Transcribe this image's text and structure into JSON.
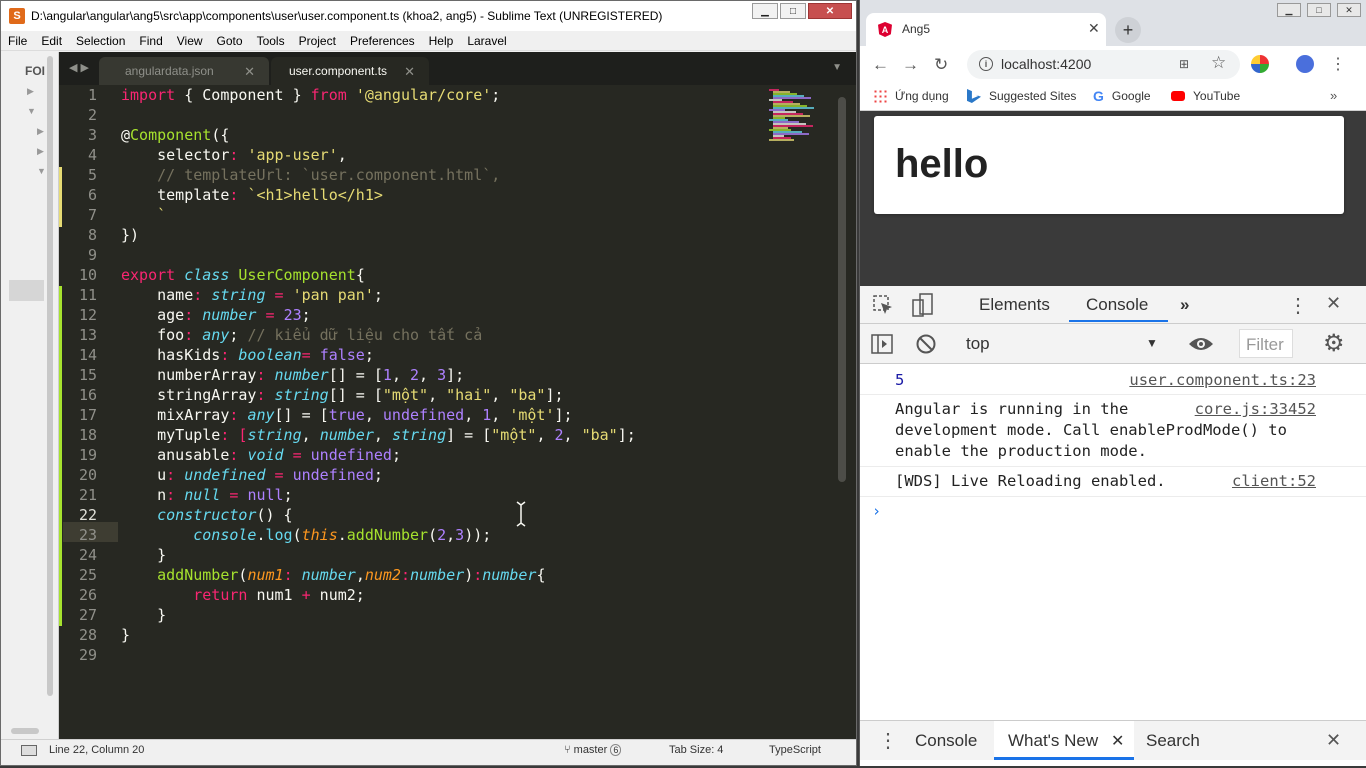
{
  "sublime": {
    "title": "D:\\angular\\angular\\ang5\\src\\app\\components\\user\\user.component.ts (khoa2, ang5) - Sublime Text (UNREGISTERED)",
    "window_controls": {
      "minimize": "▁",
      "maximize": "□",
      "close": "✕"
    },
    "menu": [
      "File",
      "Edit",
      "Selection",
      "Find",
      "View",
      "Goto",
      "Tools",
      "Project",
      "Preferences",
      "Help",
      "Laravel"
    ],
    "sidebar_label": "FOI",
    "tab_nav": "◀ ▶",
    "tabs": [
      {
        "label": "angulardata.json",
        "close": "✕"
      },
      {
        "label": "user.component.ts",
        "close": "✕"
      }
    ],
    "tab_dropdown": "▼",
    "line_numbers": [
      "1",
      "2",
      "3",
      "4",
      "5",
      "6",
      "7",
      "8",
      "9",
      "10",
      "11",
      "12",
      "13",
      "14",
      "15",
      "16",
      "17",
      "18",
      "19",
      "20",
      "21",
      "22",
      "23",
      "24",
      "25",
      "26",
      "27",
      "28",
      "29"
    ],
    "code": {
      "l1": {
        "a": "import",
        "b": " { Component } ",
        "c": "from",
        "d": " ",
        "e": "'@angular/core'",
        "f": ";"
      },
      "l3": {
        "a": "@",
        "b": "Component",
        "c": "({"
      },
      "l4": {
        "a": "    selector",
        "b": ": ",
        "c": "'app-user'",
        "d": ","
      },
      "l5": "    // templateUrl: `user.component.html`,",
      "l6": {
        "a": "    template",
        "b": ": ",
        "c": "`<h1>hello</h1>"
      },
      "l7": "    `",
      "l8": "})",
      "l10": {
        "a": "export",
        "b": " ",
        "c": "class",
        "d": " ",
        "e": "UserComponent",
        "f": "{"
      },
      "l11": {
        "a": "    name",
        "b": ": ",
        "c": "string",
        "d": " = ",
        "e": "'pan pan'",
        "f": ";"
      },
      "l12": {
        "a": "    age",
        "b": ": ",
        "c": "number",
        "d": " = ",
        "e": "23",
        "f": ";"
      },
      "l13": {
        "a": "    foo",
        "b": ": ",
        "c": "any",
        "d": "; ",
        "e": "// kiểu dữ liệu cho tất cả"
      },
      "l14": {
        "a": "    hasKids",
        "b": ": ",
        "c": "boolean",
        "d": "= ",
        "e": "false",
        "f": ";"
      },
      "l15": {
        "a": "    numberArray",
        "b": ": ",
        "c": "number",
        "d": "[] = [",
        "e": "1",
        "f": ", ",
        "g": "2",
        "h": ", ",
        "i": "3",
        "j": "];"
      },
      "l16": {
        "a": "    stringArray",
        "b": ": ",
        "c": "string",
        "d": "[] = [",
        "e": "\"một\"",
        "f": ", ",
        "g": "\"hai\"",
        "h": ", ",
        "i": "\"ba\"",
        "j": "];"
      },
      "l17": {
        "a": "    mixArray",
        "b": ": ",
        "c": "any",
        "d": "[] = [",
        "e": "true",
        "f": ", ",
        "g": "undefined",
        "h": ", ",
        "i": "1",
        "j": ", ",
        "k": "'một'",
        "l": "];"
      },
      "l18": {
        "a": "    myTuple",
        "b": ": [",
        "c": "string",
        "d": ", ",
        "e": "number",
        "f": ", ",
        "g": "string",
        "h": "] = [",
        "i": "\"một\"",
        "j": ", ",
        "k": "2",
        "l": ", ",
        "m": "\"ba\"",
        "n": "];"
      },
      "l19": {
        "a": "    anusable",
        "b": ": ",
        "c": "void",
        "d": " = ",
        "e": "undefined",
        "f": ";"
      },
      "l20": {
        "a": "    u",
        "b": ": ",
        "c": "undefined",
        "d": " = ",
        "e": "undefined",
        "f": ";"
      },
      "l21": {
        "a": "    n",
        "b": ": ",
        "c": "null",
        "d": " = ",
        "e": "null",
        "f": ";"
      },
      "l22": {
        "a": "    constructor",
        "b": "() {"
      },
      "l23": {
        "a": "        ",
        "b": "console",
        "c": ".",
        "d": "log",
        "e": "(",
        "f": "this",
        "g": ".",
        "h": "addNumber",
        "i": "(",
        "j": "2",
        "k": ",",
        "l": "3",
        "m": "));"
      },
      "l24": "    }",
      "l25": {
        "a": "    addNumber",
        "b": "(",
        "c": "num1",
        "d": ": ",
        "e": "number",
        "f": ",",
        "g": "num2",
        "h": ":",
        "i": "number",
        "j": ")",
        "k": ":",
        "l": "number",
        "m": "{"
      },
      "l26": {
        "a": "        ",
        "b": "return",
        "c": " num1 ",
        "d": "+",
        "e": " num2;"
      },
      "l27": "    }",
      "l28": "}"
    },
    "status": {
      "position": "Line 22, Column 20",
      "branch": "master",
      "branch_badge": "6",
      "tab_size": "Tab Size: 4",
      "syntax": "TypeScript"
    }
  },
  "chrome": {
    "tab_title": "Ang5",
    "tab_close": "✕",
    "new_tab": "+",
    "window_controls": {
      "minimize": "▁",
      "maximize": "□",
      "close": "✕"
    },
    "url": "localhost:4200",
    "bookmarks": [
      {
        "label": "Ứng dụng",
        "icon": "apps-grid-icon"
      },
      {
        "label": "Suggested Sites",
        "icon": "bing-icon"
      },
      {
        "label": "Google",
        "icon": "google-icon"
      },
      {
        "label": "YouTube",
        "icon": "youtube-icon"
      }
    ],
    "bookmarks_more": "»",
    "page": {
      "heading": "hello"
    },
    "devtools": {
      "tabs": [
        "Elements",
        "Console",
        "»"
      ],
      "close": "✕",
      "context": "top",
      "filter_placeholder": "Filter",
      "messages": [
        {
          "text": "5",
          "source": "user.component.ts:23"
        },
        {
          "text": "Angular is running in the\ndevelopment mode. Call enableProdMode() to\nenable the production mode.",
          "source": "core.js:33452"
        },
        {
          "text": "[WDS] Live Reloading enabled.",
          "source": "client:52"
        }
      ],
      "prompt": "›",
      "drawer_tabs": [
        "Console",
        "What's New",
        "Search"
      ],
      "drawer_tab_close": "✕",
      "drawer_close": "✕"
    }
  },
  "colors": {
    "editor_bg": "#272822",
    "keyword": "#f92672",
    "string": "#e6db74",
    "comment": "#75715e",
    "type": "#66d9ef",
    "function": "#a6e22e",
    "number": "#ae81ff",
    "devtools_accent": "#1a73e8",
    "angular_red": "#dd0031"
  }
}
